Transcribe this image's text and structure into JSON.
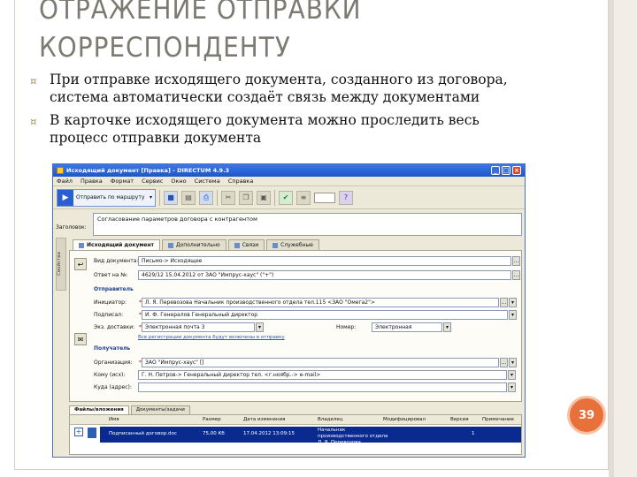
{
  "slide": {
    "title_line1": "ОТРАЖЕНИЕ ОТПРАВКИ",
    "title_line2": "КОРРЕСПОНДЕНТУ",
    "bullet1_line1": "При отправке исходящего документа, созданного из договора,",
    "bullet1_line2": "система автоматически создаёт связь между документами",
    "bullet2_line1": "В карточке исходящего документа можно проследить весь",
    "bullet2_line2": "процесс отправки документа",
    "page_number": "39",
    "colors": {
      "title": "#7d7a72",
      "bullet_marker": "#a3935b",
      "page_badge": "#e8703a"
    }
  },
  "window": {
    "title": "Исходящий документ [Правка] - DIRECTUM 4.9.3",
    "menu": [
      "Файл",
      "Правка",
      "Формат",
      "Сервис",
      "Окно",
      "Система",
      "Справка"
    ],
    "send_button_label": "Отправить по маршруту",
    "subject_label": "Заголовок:",
    "subject_value": "Согласование параметров договора с контрагентом",
    "sidebar_label": "Свойства",
    "tabs": [
      "Исходящий документ",
      "Дополнительно",
      "Связи",
      "Служебные"
    ],
    "fields": {
      "in_reply_label": "Вид документа:",
      "in_reply_value": "Письмо-> Исходящее",
      "reply_to_label": "Ответ на №:",
      "reply_to_value": "4629/12 15.04.2012 от ЗАО \"Импрус-хаус\" (\"+\")",
      "sender_section": "Отправитель",
      "initiator_label": "Инициатор:",
      "initiator_value": "Л. Я. Перевозова Начальник производственного отдела тел.115 <ЗАО \"Омега2\">",
      "signed_label": "Подписал:",
      "signed_value": "И. Ф. Генералов Генеральный директор",
      "delivery_label": "Экз. доставки:",
      "delivery_value": "Электронная почта 3",
      "copies_label": "Номер:",
      "copies_value": "Электронная",
      "delivery_link": "Все регистрации документа будут включены в отправку",
      "recipient_section": "Получатель",
      "org_label": "Организация:",
      "org_value": "ЗАО \"Импрус-хаус\" []",
      "to_label": "Кому (исх):",
      "to_value": "Г. Н. Петров-> Генеральный директор тел. <г.ноябр.-> e-mail>",
      "where_label": "Куда (адрес):",
      "where_value": ""
    },
    "bottom_tabs": [
      "Файлы/вложения",
      "Документы/задачи"
    ],
    "file_columns": [
      "Имя",
      "Размер",
      "Дата изменения",
      "Владелец",
      "Модифицировал",
      "Версия",
      "Примечание"
    ],
    "file_row": {
      "name": "Подписанный договор.doc",
      "size": "75,00 Кб",
      "date": "17.04.2012 13:09:15",
      "owner": "Начальник производственного отдела Л. Я. Перевозова",
      "version": "1"
    }
  }
}
